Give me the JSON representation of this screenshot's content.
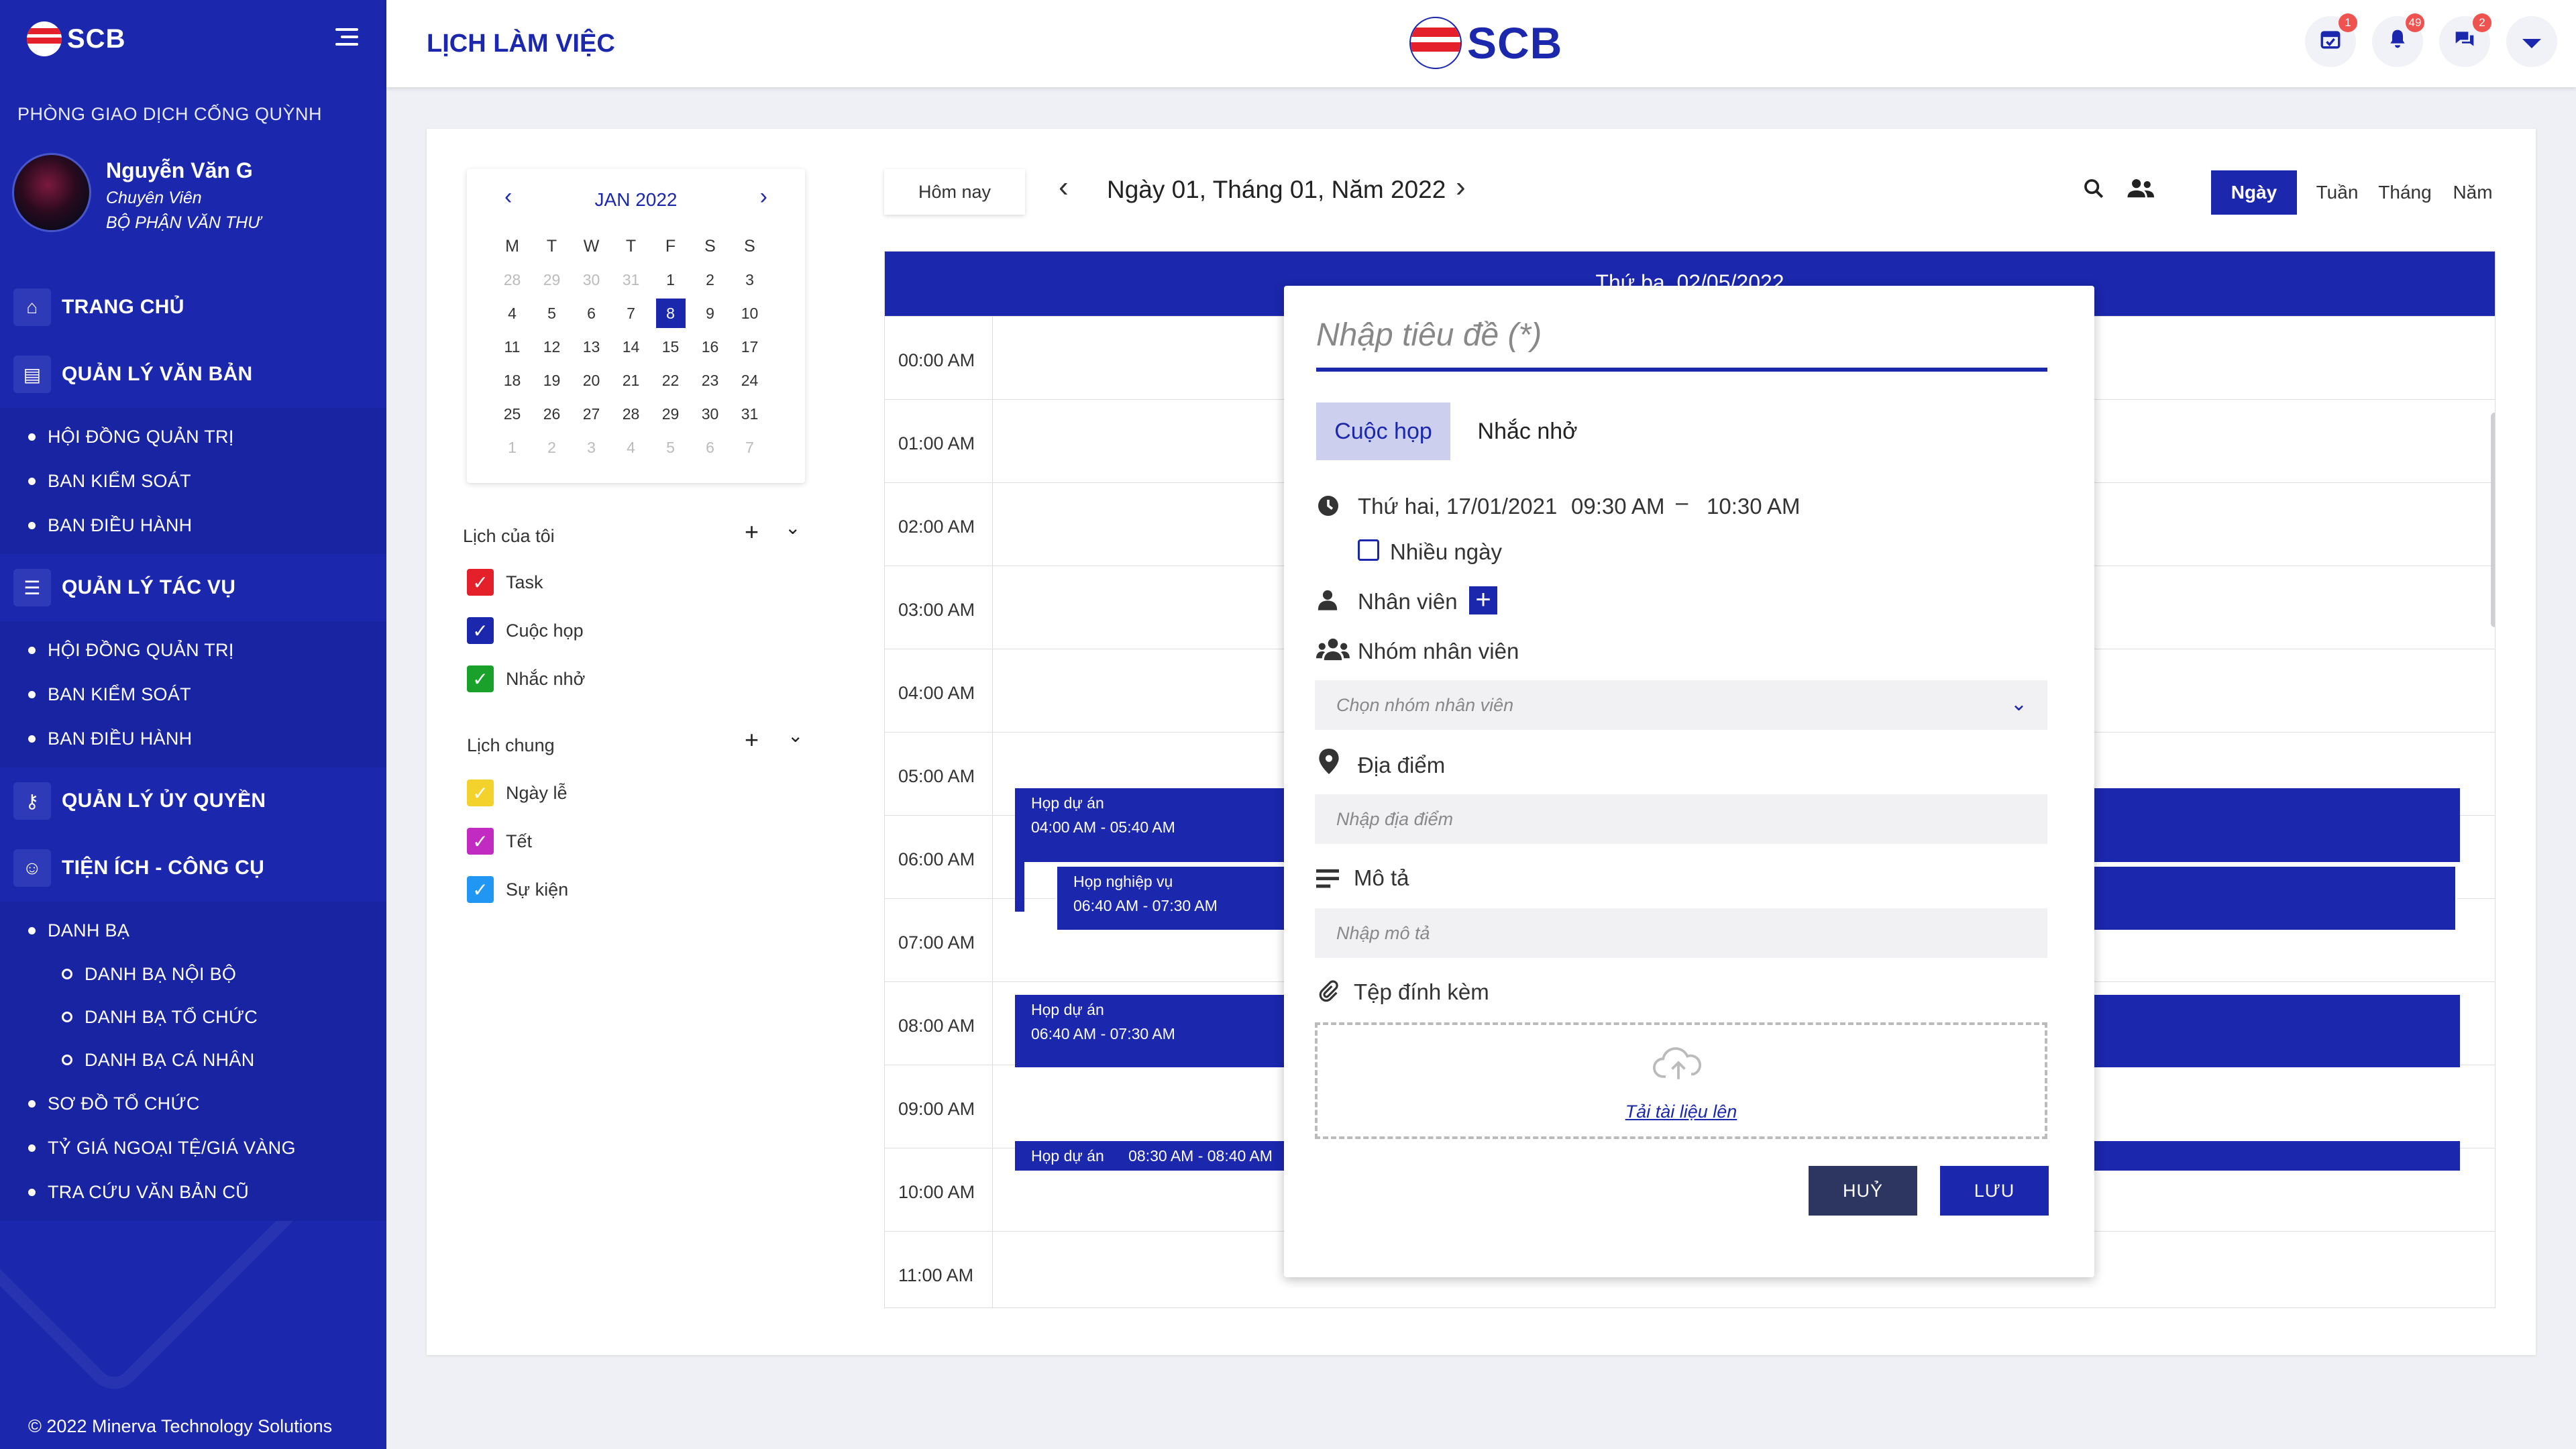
{
  "sidebar": {
    "brand": "SCB",
    "branch": "PHÒNG GIAO DỊCH CỐNG QUỲNH",
    "user": {
      "name": "Nguyễn Văn G",
      "role": "Chuyên Viên",
      "dept": "BỘ PHẬN VĂN THƯ"
    },
    "menu": {
      "home": "TRANG CHỦ",
      "docs": "QUẢN LÝ VĂN BẢN",
      "docs_sub": [
        "HỘI ĐỒNG QUẢN TRỊ",
        "BAN KIỂM SOÁT",
        "BAN ĐIỀU HÀNH"
      ],
      "tasks": "QUẢN LÝ TÁC VỤ",
      "tasks_sub": [
        "HỘI ĐỒNG QUẢN TRỊ",
        "BAN KIỂM SOÁT",
        "BAN ĐIỀU HÀNH"
      ],
      "delegation": "QUẢN LÝ ỦY QUYỀN",
      "tools": "TIỆN ÍCH - CÔNG CỤ",
      "tools_sub": {
        "contacts": "DANH BẠ",
        "contacts_sub": [
          "DANH BẠ NỘI BỘ",
          "DANH BẠ TỔ CHỨC",
          "DANH BẠ CÁ NHÂN"
        ],
        "org": "SƠ ĐỒ TỔ CHỨC",
        "fx": "TỶ GIÁ NGOẠI TỆ/GIÁ VÀNG",
        "old_docs": "TRA CỨU VĂN BẢN CŨ"
      }
    },
    "footer": "© 2022 Minerva Technology Solutions"
  },
  "header": {
    "title": "LỊCH LÀM VIỆC",
    "logo": "SCB",
    "badges": {
      "calendar": "1",
      "notifications": "49",
      "messages": "2"
    }
  },
  "mini_calendar": {
    "month": "JAN 2022",
    "weekdays": [
      "M",
      "T",
      "W",
      "T",
      "F",
      "S",
      "S"
    ],
    "weeks": [
      [
        "28",
        "29",
        "30",
        "31",
        "1",
        "2",
        "3"
      ],
      [
        "4",
        "5",
        "6",
        "7",
        "8",
        "9",
        "10"
      ],
      [
        "11",
        "12",
        "13",
        "14",
        "15",
        "16",
        "17"
      ],
      [
        "18",
        "19",
        "20",
        "21",
        "22",
        "23",
        "24"
      ],
      [
        "25",
        "26",
        "27",
        "28",
        "29",
        "30",
        "31"
      ],
      [
        "1",
        "2",
        "3",
        "4",
        "5",
        "6",
        "7"
      ]
    ],
    "selected": "8"
  },
  "my_calendars": {
    "title": "Lịch của tôi",
    "items": [
      {
        "label": "Task",
        "color": "#e4202b"
      },
      {
        "label": "Cuộc họp",
        "color": "#1b27ad"
      },
      {
        "label": "Nhắc nhở",
        "color": "#1aa12b"
      }
    ]
  },
  "shared_calendars": {
    "title": "Lịch chung",
    "items": [
      {
        "label": "Ngày lễ",
        "color": "#f2d22b"
      },
      {
        "label": "Tết",
        "color": "#c22bc2"
      },
      {
        "label": "Sự kiện",
        "color": "#2196f3"
      }
    ]
  },
  "toolbar": {
    "today": "Hôm nay",
    "date_title": "Ngày 01, Tháng 01, Năm 2022",
    "views": [
      "Ngày",
      "Tuần",
      "Tháng",
      "Năm"
    ],
    "active_view": "Ngày"
  },
  "day_view": {
    "header": "Thứ ba, 02/05/2022",
    "times": [
      "00:00 AM",
      "01:00 AM",
      "02:00 AM",
      "03:00 AM",
      "04:00 AM",
      "05:00 AM",
      "06:00 AM",
      "07:00 AM",
      "08:00 AM",
      "09:00 AM",
      "10:00 AM",
      "11:00 AM"
    ],
    "events": [
      {
        "title": "Họp dự án",
        "time": "04:00 AM - 05:40 AM"
      },
      {
        "title": "Họp nghiệp vụ",
        "time": "06:40 AM - 07:30 AM"
      },
      {
        "title": "Họp dự án",
        "time": "06:40 AM - 07:30 AM"
      },
      {
        "title": "Họp dự án",
        "time": "08:30 AM - 08:40 AM"
      }
    ]
  },
  "modal": {
    "title_placeholder": "Nhập tiêu đề (*)",
    "tabs": [
      "Cuộc họp",
      "Nhắc nhở"
    ],
    "date": "Thứ hai, 17/01/2021",
    "start": "09:30 AM",
    "dash": "–",
    "end": "10:30 AM",
    "multi_day": "Nhiều ngày",
    "employee": "Nhân viên",
    "employee_group": "Nhóm nhân viên",
    "group_placeholder": "Chọn nhóm nhân viên",
    "location": "Địa điểm",
    "location_placeholder": "Nhập địa điểm",
    "description": "Mô tả",
    "description_placeholder": "Nhập mô tả",
    "attachment": "Tệp đính kèm",
    "upload": "Tải tài liệu lên",
    "cancel": "HUỶ",
    "save": "LƯU"
  },
  "colors": {
    "primary": "#1b27ad",
    "cancel": "#2d3561",
    "badge": "#ef5350"
  }
}
